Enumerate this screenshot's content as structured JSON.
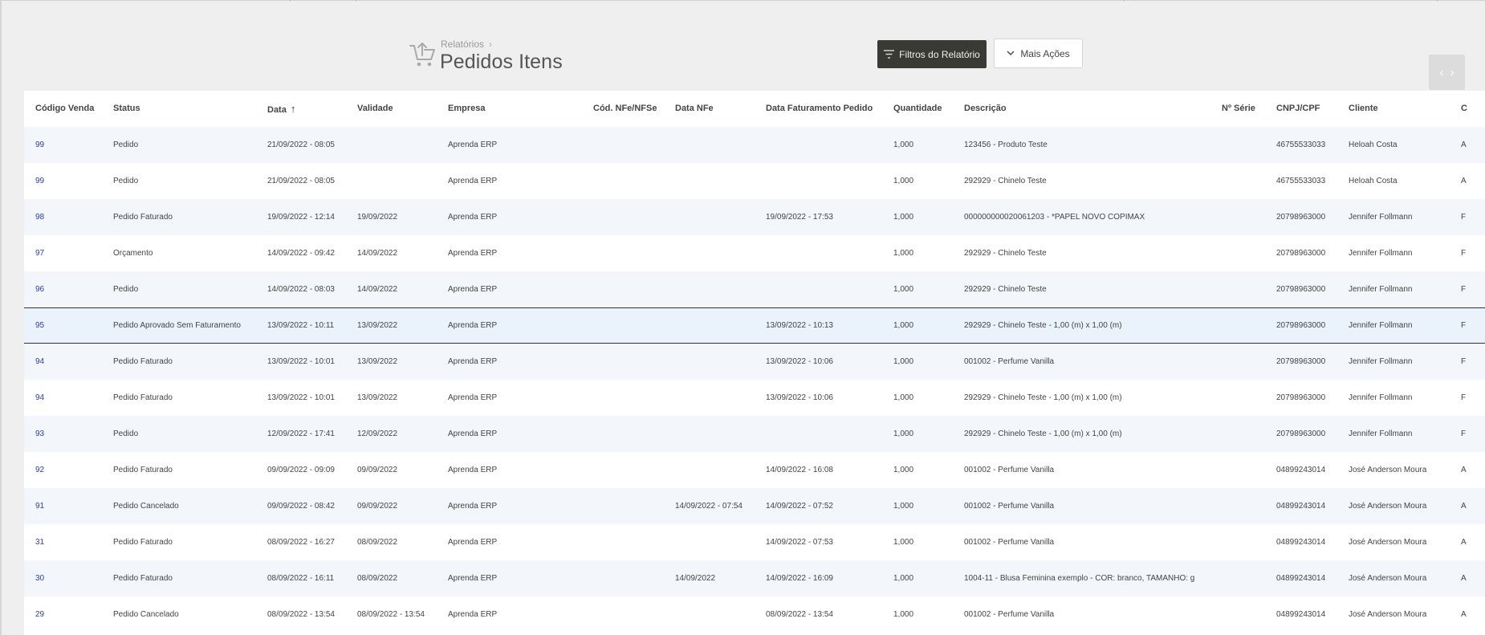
{
  "header": {
    "breadcrumb_parent": "Relatórios",
    "title": "Pedidos Itens",
    "icon": "cart-upload-icon"
  },
  "toolbar": {
    "filter_label": "Filtros do Relatório",
    "more_actions_label": "Mais Ações"
  },
  "table": {
    "columns": [
      "Código Venda",
      "Status",
      "Data",
      "Validade",
      "Empresa",
      "Cód. NFe/NFSe",
      "Data NFe",
      "Data Faturamento Pedido",
      "Quantidade",
      "Descrição",
      "Nº Série",
      "CNPJ/CPF",
      "Cliente",
      "C"
    ],
    "sorted_column": "Data",
    "sort_direction": "ascending",
    "selected_row": 5,
    "rows": [
      [
        "99",
        "Pedido",
        "21/09/2022 - 08:05",
        "",
        "Aprenda ERP",
        "",
        "",
        "",
        "1,000",
        "123456 - Produto Teste",
        "",
        "46755533033",
        "Heloah Costa",
        "A"
      ],
      [
        "99",
        "Pedido",
        "21/09/2022 - 08:05",
        "",
        "Aprenda ERP",
        "",
        "",
        "",
        "1,000",
        "292929 - Chinelo Teste",
        "",
        "46755533033",
        "Heloah Costa",
        "A"
      ],
      [
        "98",
        "Pedido Faturado",
        "19/09/2022 - 12:14",
        "19/09/2022",
        "Aprenda ERP",
        "",
        "",
        "19/09/2022 - 17:53",
        "1,000",
        "000000000020061203 - *PAPEL NOVO COPIMAX",
        "",
        "20798963000",
        "Jennifer Follmann",
        "F"
      ],
      [
        "97",
        "Orçamento",
        "14/09/2022 - 09:42",
        "14/09/2022",
        "Aprenda ERP",
        "",
        "",
        "",
        "1,000",
        "292929 - Chinelo Teste",
        "",
        "20798963000",
        "Jennifer Follmann",
        "F"
      ],
      [
        "96",
        "Pedido",
        "14/09/2022 - 08:03",
        "14/09/2022",
        "Aprenda ERP",
        "",
        "",
        "",
        "1,000",
        "292929 - Chinelo Teste",
        "",
        "20798963000",
        "Jennifer Follmann",
        "F"
      ],
      [
        "95",
        "Pedido Aprovado Sem Faturamento",
        "13/09/2022 - 10:11",
        "13/09/2022",
        "Aprenda ERP",
        "",
        "",
        "13/09/2022 - 10:13",
        "1,000",
        "292929 - Chinelo Teste - 1,00 (m) x 1,00 (m)",
        "",
        "20798963000",
        "Jennifer Follmann",
        "F"
      ],
      [
        "94",
        "Pedido Faturado",
        "13/09/2022 - 10:01",
        "13/09/2022",
        "Aprenda ERP",
        "",
        "",
        "13/09/2022 - 10:06",
        "1,000",
        "001002 - Perfume Vanilla",
        "",
        "20798963000",
        "Jennifer Follmann",
        "F"
      ],
      [
        "94",
        "Pedido Faturado",
        "13/09/2022 - 10:01",
        "13/09/2022",
        "Aprenda ERP",
        "",
        "",
        "13/09/2022 - 10:06",
        "1,000",
        "292929 - Chinelo Teste - 1,00 (m) x 1,00 (m)",
        "",
        "20798963000",
        "Jennifer Follmann",
        "F"
      ],
      [
        "93",
        "Pedido",
        "12/09/2022 - 17:41",
        "12/09/2022",
        "Aprenda ERP",
        "",
        "",
        "",
        "1,000",
        "292929 - Chinelo Teste - 1,00 (m) x 1,00 (m)",
        "",
        "20798963000",
        "Jennifer Follmann",
        "F"
      ],
      [
        "92",
        "Pedido Faturado",
        "09/09/2022 - 09:09",
        "09/09/2022",
        "Aprenda ERP",
        "",
        "",
        "14/09/2022 - 16:08",
        "1,000",
        "001002 - Perfume Vanilla",
        "",
        "04899243014",
        "José Anderson Moura",
        "A"
      ],
      [
        "91",
        "Pedido Cancelado",
        "09/09/2022 - 08:42",
        "09/09/2022",
        "Aprenda ERP",
        "",
        "14/09/2022 - 07:54",
        "14/09/2022 - 07:52",
        "1,000",
        "001002 - Perfume Vanilla",
        "",
        "04899243014",
        "José Anderson Moura",
        "A"
      ],
      [
        "31",
        "Pedido Faturado",
        "08/09/2022 - 16:27",
        "08/09/2022",
        "Aprenda ERP",
        "",
        "",
        "14/09/2022 - 07:53",
        "1,000",
        "001002 - Perfume Vanilla",
        "",
        "04899243014",
        "José Anderson Moura",
        "A"
      ],
      [
        "30",
        "Pedido Faturado",
        "08/09/2022 - 16:11",
        "08/09/2022",
        "Aprenda ERP",
        "",
        "14/09/2022",
        "14/09/2022 - 16:09",
        "1,000",
        "1004-11 - Blusa Feminina exemplo - COR: branco, TAMANHO: g",
        "",
        "04899243014",
        "José Anderson Moura",
        "A"
      ],
      [
        "29",
        "Pedido Cancelado",
        "08/09/2022 - 13:54",
        "08/09/2022 - 13:54",
        "Aprenda ERP",
        "",
        "",
        "08/09/2022 - 13:54",
        "1,000",
        "001002 - Perfume Vanilla",
        "",
        "04899243014",
        "José Anderson Moura",
        "A"
      ]
    ]
  }
}
